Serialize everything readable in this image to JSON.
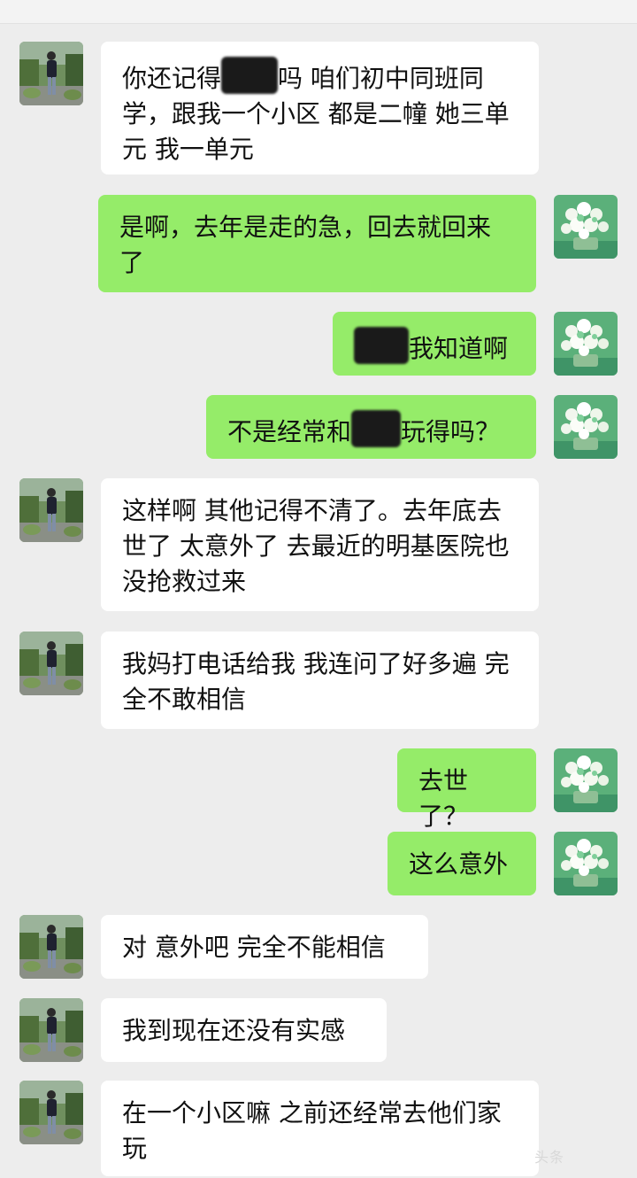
{
  "chat": {
    "messages": [
      {
        "side": "in",
        "avatar_icon": "user-photo-avatar",
        "parts": [
          {
            "text": "你还记得"
          },
          {
            "redacted": true,
            "w": 64,
            "label": "[name]"
          },
          {
            "text": "吗 咱们初中同班同学，跟我一个小区 都是二幢 她三单元 我一单元"
          }
        ]
      },
      {
        "side": "out",
        "avatar_icon": "flower-painting-avatar",
        "parts": [
          {
            "text": "是啊，去年是走的急，回去就回来了"
          }
        ]
      },
      {
        "side": "out",
        "avatar_icon": "flower-painting-avatar",
        "parts": [
          {
            "redacted": true,
            "w": 62,
            "label": "[name]"
          },
          {
            "text": "我知道啊"
          }
        ]
      },
      {
        "side": "out",
        "avatar_icon": "flower-painting-avatar",
        "parts": [
          {
            "text": "不是经常和"
          },
          {
            "redacted": true,
            "w": 56,
            "label": "[name]"
          },
          {
            "text": "玩得吗？"
          }
        ]
      },
      {
        "side": "in",
        "avatar_icon": "user-photo-avatar",
        "parts": [
          {
            "text": "这样啊 其他记得不清了。去年底去世了 太意外了 去最近的明基医院也没抢救过来"
          }
        ]
      },
      {
        "side": "in",
        "avatar_icon": "user-photo-avatar",
        "parts": [
          {
            "text": "我妈打电话给我 我连问了好多遍 完全不敢相信"
          }
        ]
      },
      {
        "side": "out",
        "avatar_icon": "flower-painting-avatar",
        "parts": [
          {
            "text": "去世了？"
          }
        ]
      },
      {
        "side": "out",
        "avatar_icon": "flower-painting-avatar",
        "parts": [
          {
            "text": "这么意外"
          }
        ]
      },
      {
        "side": "in",
        "avatar_icon": "user-photo-avatar",
        "parts": [
          {
            "text": "对 意外吧 完全不能相信"
          }
        ]
      },
      {
        "side": "in",
        "avatar_icon": "user-photo-avatar",
        "parts": [
          {
            "text": "我到现在还没有实感"
          }
        ]
      },
      {
        "side": "in",
        "avatar_icon": "user-photo-avatar",
        "parts": [
          {
            "text": "在一个小区嘛 之前还经常去他们家玩"
          }
        ]
      }
    ]
  },
  "watermark": {
    "text": "头条"
  }
}
